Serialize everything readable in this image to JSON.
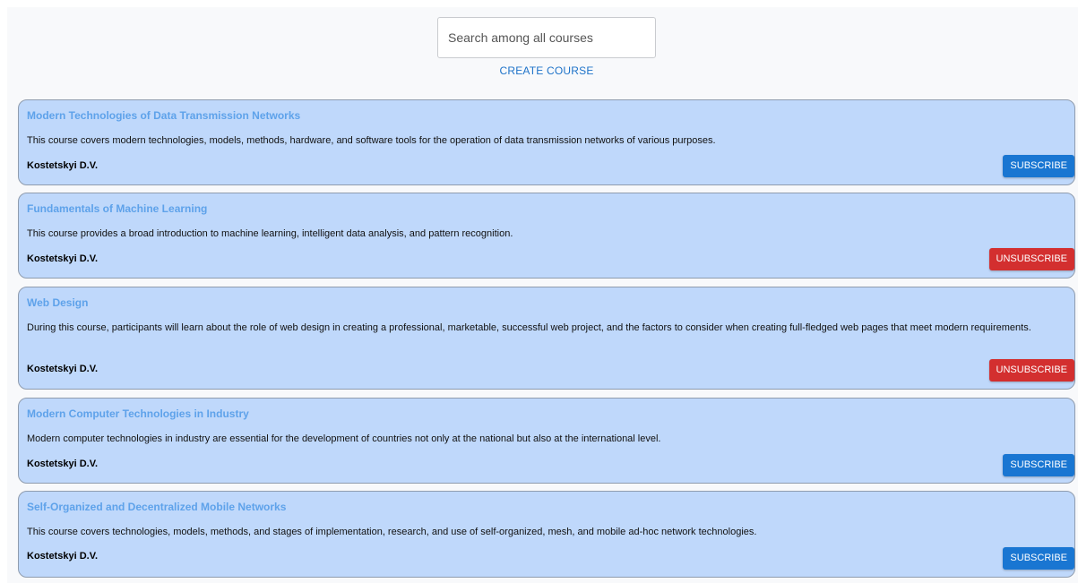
{
  "search": {
    "placeholder": "Search among all courses",
    "value": ""
  },
  "create_course_label": "CREATE COURSE",
  "colors": {
    "card_bg": "#bfd8fb",
    "title": "#5ea2ea",
    "subscribe": "#1976d2",
    "unsubscribe": "#d32f2f",
    "link": "#1e73c9"
  },
  "courses": [
    {
      "title": "Modern Technologies of Data Transmission Networks",
      "description": "This course covers modern technologies, models, methods, hardware, and software tools for the operation of data transmission networks of various purposes.",
      "author": "Kostetskyi D.V.",
      "action_label": "SUBSCRIBE"
    },
    {
      "title": "Fundamentals of Machine Learning",
      "description": "This course provides a broad introduction to machine learning, intelligent data analysis, and pattern recognition.",
      "author": "Kostetskyi D.V.",
      "action_label": "UNSUBSCRIBE"
    },
    {
      "title": "Web Design",
      "description": "During this course, participants will learn about the role of web design in creating a professional, marketable, successful web project, and the factors to consider when creating full-fledged web pages that meet modern requirements.",
      "author": "Kostetskyi D.V.",
      "action_label": "UNSUBSCRIBE"
    },
    {
      "title": "Modern Computer Technologies in Industry",
      "description": "Modern computer technologies in industry are essential for the development of countries not only at the national but also at the international level.",
      "author": "Kostetskyi D.V.",
      "action_label": "SUBSCRIBE"
    },
    {
      "title": "Self-Organized and Decentralized Mobile Networks",
      "description": "This course covers technologies, models, methods, and stages of implementation, research, and use of self-organized, mesh, and mobile ad-hoc network technologies.",
      "author": "Kostetskyi D.V.",
      "action_label": "SUBSCRIBE"
    }
  ]
}
